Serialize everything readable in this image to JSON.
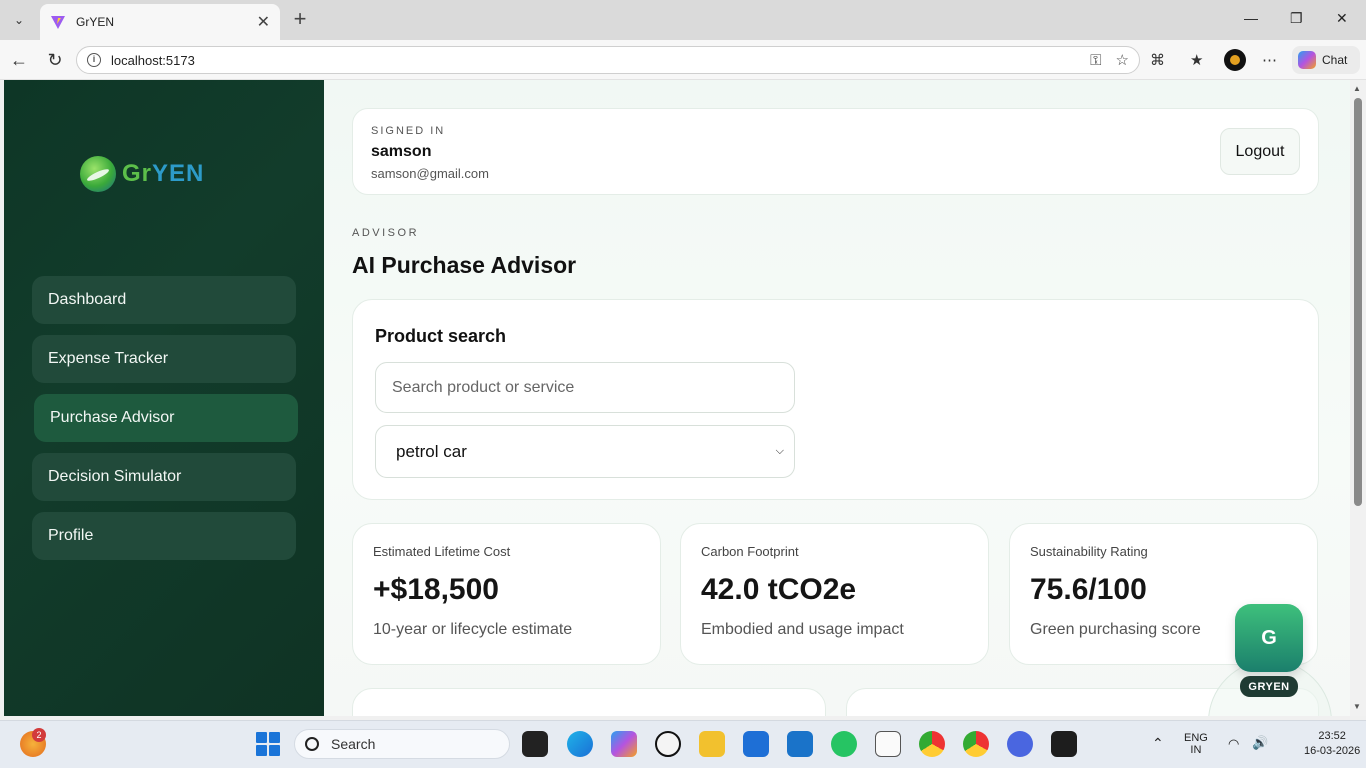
{
  "browser": {
    "tab_title": "GrYEN",
    "url": "localhost:5173",
    "chat_label": "Chat"
  },
  "app": {
    "logo_text_1": "Gr",
    "logo_text_2": "YEN",
    "nav": [
      {
        "label": "Dashboard",
        "active": false
      },
      {
        "label": "Expense Tracker",
        "active": false
      },
      {
        "label": "Purchase Advisor",
        "active": true
      },
      {
        "label": "Decision Simulator",
        "active": false
      },
      {
        "label": "Profile",
        "active": false
      }
    ]
  },
  "user": {
    "signed_in_label": "SIGNED IN",
    "name": "samson",
    "email": "samson@gmail.com",
    "logout_label": "Logout"
  },
  "page": {
    "section_label": "ADVISOR",
    "title": "AI Purchase Advisor"
  },
  "search": {
    "heading": "Product search",
    "placeholder": "Search product or service",
    "selected_option": "petrol car"
  },
  "stats": [
    {
      "label": "Estimated Lifetime Cost",
      "value": "+$18,500",
      "sub": "10-year or lifecycle estimate"
    },
    {
      "label": "Carbon Footprint",
      "value": "42.0 tCO2e",
      "sub": "Embodied and usage impact"
    },
    {
      "label": "Sustainability Rating",
      "value": "75.6/100",
      "sub": "Green purchasing score"
    }
  ],
  "assistant": {
    "icon_letter": "G",
    "label": "GRYEN"
  },
  "taskbar": {
    "search_label": "Search",
    "notification_count": "2",
    "language_1": "ENG",
    "language_2": "IN",
    "time": "23:52",
    "date": "16-03-2026"
  }
}
